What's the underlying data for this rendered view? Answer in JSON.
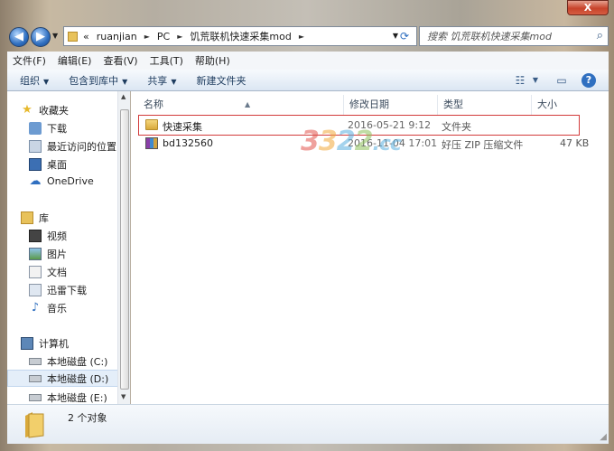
{
  "window": {
    "close_label": "X"
  },
  "address": {
    "chevron": "«",
    "breadcrumbs": [
      "ruanjian",
      "PC",
      "饥荒联机快速采集mod"
    ],
    "separator": "►"
  },
  "search": {
    "placeholder": "搜索 饥荒联机快速采集mod"
  },
  "menubar": [
    "文件(F)",
    "编辑(E)",
    "查看(V)",
    "工具(T)",
    "帮助(H)"
  ],
  "toolbar": {
    "organize": "组织",
    "include_in_library": "包含到库中",
    "share": "共享",
    "new_folder": "新建文件夹"
  },
  "nav": {
    "favorites": "收藏夹",
    "downloads": "下载",
    "recent": "最近访问的位置",
    "desktop": "桌面",
    "onedrive": "OneDrive",
    "libraries": "库",
    "videos": "视频",
    "pictures": "图片",
    "documents": "文档",
    "thunder": "迅雷下载",
    "music": "音乐",
    "computer": "计算机",
    "disk_c": "本地磁盘 (C:)",
    "disk_d": "本地磁盘 (D:)",
    "disk_e": "本地磁盘 (E:)"
  },
  "columns": {
    "name": "名称",
    "date": "修改日期",
    "type": "类型",
    "size": "大小"
  },
  "files": [
    {
      "name": "快速采集",
      "date": "2016-05-21 9:12",
      "type": "文件夹",
      "size": ""
    },
    {
      "name": "bd132560",
      "date": "2016-11-04 17:01",
      "type": "好压 ZIP 压缩文件",
      "size": "47 KB"
    }
  ],
  "watermark": {
    "a": "3",
    "b": "3",
    "c": "2",
    "d": "2",
    "suffix": ".cc"
  },
  "status": {
    "count": "2 个对象"
  },
  "colors": {
    "highlight": "#d23b3b",
    "folder": "#e8c25b",
    "accent": "#2f6fc0"
  }
}
